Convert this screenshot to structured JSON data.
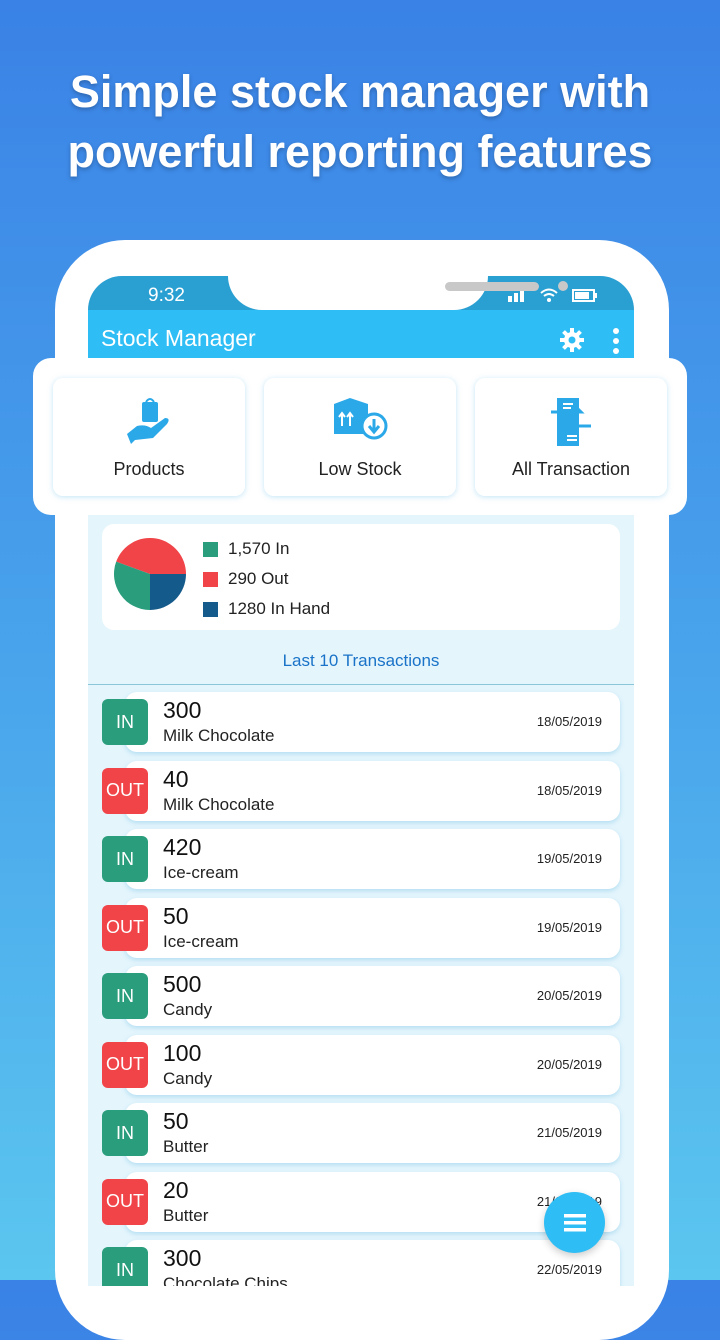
{
  "headline": [
    "Simple stock manager with",
    "powerful reporting features"
  ],
  "status": {
    "time": "9:32"
  },
  "appbar": {
    "title": "Stock Manager",
    "settings_icon": "gear-icon",
    "menu_icon": "more-vertical-icon"
  },
  "shortcuts": [
    {
      "label": "Products",
      "icon": "hand-bag-icon"
    },
    {
      "label": "Low Stock",
      "icon": "box-download-icon"
    },
    {
      "label": "All Transaction",
      "icon": "transfer-document-icon"
    }
  ],
  "summary": {
    "legend": [
      {
        "label": "1,570 In",
        "color": "#2a9d7c"
      },
      {
        "label": "290 Out",
        "color": "#f04448"
      },
      {
        "label": "1280 In Hand",
        "color": "#145a8a"
      }
    ]
  },
  "last_label": "Last 10 Transactions",
  "colors": {
    "in": "#2a9d7c",
    "out": "#f04448",
    "accent": "#2ebdf4"
  },
  "transactions": [
    {
      "type": "IN",
      "qty": "300",
      "name": "Milk Chocolate",
      "date": "18/05/2019"
    },
    {
      "type": "OUT",
      "qty": "40",
      "name": "Milk Chocolate",
      "date": "18/05/2019"
    },
    {
      "type": "IN",
      "qty": "420",
      "name": "Ice-cream",
      "date": "19/05/2019"
    },
    {
      "type": "OUT",
      "qty": "50",
      "name": "Ice-cream",
      "date": "19/05/2019"
    },
    {
      "type": "IN",
      "qty": "500",
      "name": "Candy",
      "date": "20/05/2019"
    },
    {
      "type": "OUT",
      "qty": "100",
      "name": "Candy",
      "date": "20/05/2019"
    },
    {
      "type": "IN",
      "qty": "50",
      "name": "Butter",
      "date": "21/05/2019"
    },
    {
      "type": "OUT",
      "qty": "20",
      "name": "Butter",
      "date": "21/05/2019"
    },
    {
      "type": "IN",
      "qty": "300",
      "name": "Chocolate Chips",
      "date": "22/05/2019"
    }
  ],
  "fab_icon": "hamburger-menu-icon"
}
